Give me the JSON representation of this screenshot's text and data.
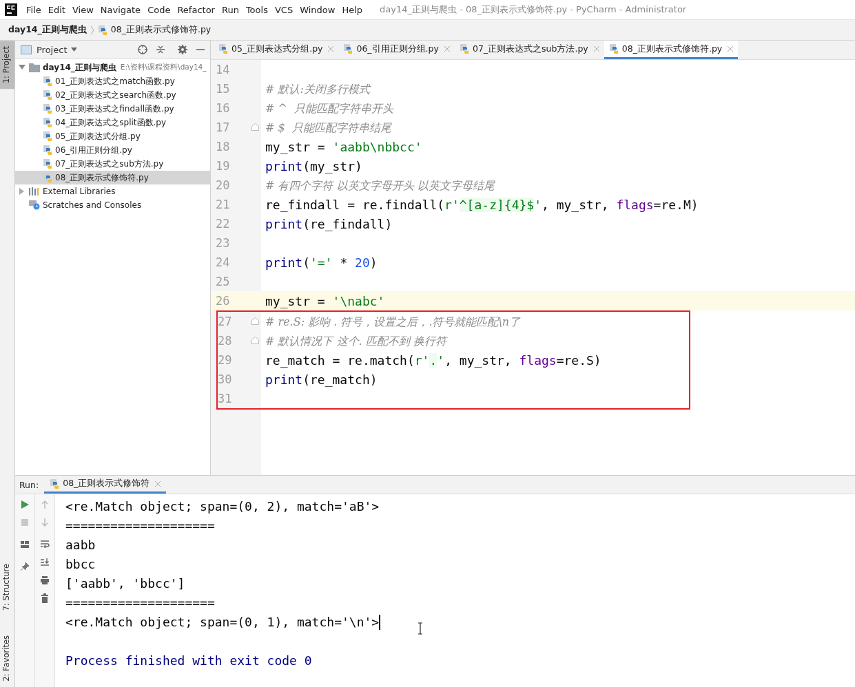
{
  "window": {
    "title": "day14_正则与爬虫 - 08_正则表示式修饰符.py - PyCharm - Administrator",
    "menu": [
      "File",
      "Edit",
      "View",
      "Navigate",
      "Code",
      "Refactor",
      "Run",
      "Tools",
      "VCS",
      "Window",
      "Help"
    ]
  },
  "breadcrumb": [
    "day14_正则与爬虫",
    "08_正则表示式修饰符.py"
  ],
  "left_stripe": [
    {
      "label": "1: Project",
      "selected": true
    },
    {
      "label": "7: Structure",
      "selected": false
    },
    {
      "label": "2: Favorites",
      "selected": false
    }
  ],
  "project_panel": {
    "title": "Project",
    "tree": [
      {
        "label": "day14_正则与爬虫",
        "path": "E:\\资料\\课程资料\\day14_",
        "kind": "folder",
        "expanded": true,
        "selected": false,
        "children": [
          {
            "label": "01_正则表达式之match函数.py",
            "kind": "file",
            "selected": false
          },
          {
            "label": "02_正则表达式之search函数.py",
            "kind": "file",
            "selected": false
          },
          {
            "label": "03_正则表达式之findall函数.py",
            "kind": "file",
            "selected": false
          },
          {
            "label": "04_正则表达式之split函数.py",
            "kind": "file",
            "selected": false
          },
          {
            "label": "05_正则表达式分组.py",
            "kind": "file",
            "selected": false
          },
          {
            "label": "06_引用正则分组.py",
            "kind": "file",
            "selected": false
          },
          {
            "label": "07_正则表达式之sub方法.py",
            "kind": "file",
            "selected": false
          },
          {
            "label": "08_正则表示式修饰符.py",
            "kind": "file",
            "selected": true
          }
        ]
      },
      {
        "label": "External Libraries",
        "kind": "library",
        "expanded": false,
        "selected": false
      },
      {
        "label": "Scratches and Consoles",
        "kind": "scratch",
        "selected": false
      }
    ]
  },
  "editor_tabs": [
    {
      "label": "05_正则表达式分组.py",
      "selected": false
    },
    {
      "label": "06_引用正则分组.py",
      "selected": false
    },
    {
      "label": "07_正则表达式之sub方法.py",
      "selected": false
    },
    {
      "label": "08_正则表示式修饰符.py",
      "selected": true
    }
  ],
  "code_lines": [
    {
      "number": "14",
      "current": false,
      "fold": false,
      "boxed": false
    },
    {
      "number": "15",
      "current": false,
      "fold": false,
      "boxed": false,
      "tokens": [
        {
          "kind": "comment",
          "text": "# 默认:关闭多行模式"
        }
      ]
    },
    {
      "number": "16",
      "current": false,
      "fold": false,
      "boxed": false,
      "tokens": [
        {
          "kind": "comment",
          "text": "# ^  只能匹配字符串开头"
        }
      ]
    },
    {
      "number": "17",
      "current": false,
      "fold": true,
      "boxed": false,
      "tokens": [
        {
          "kind": "comment",
          "text": "# $  只能匹配字符串结尾"
        }
      ]
    },
    {
      "number": "18",
      "current": false,
      "fold": false,
      "boxed": false,
      "tokens": [
        {
          "kind": "plain",
          "text": "my_str = "
        },
        {
          "kind": "string",
          "text": "'aabb\\nbbcc'"
        }
      ]
    },
    {
      "number": "19",
      "current": false,
      "fold": false,
      "boxed": false,
      "tokens": [
        {
          "kind": "builtin",
          "text": "print"
        },
        {
          "kind": "plain",
          "text": "(my_str)"
        }
      ]
    },
    {
      "number": "20",
      "current": false,
      "fold": false,
      "boxed": false,
      "tokens": [
        {
          "kind": "comment",
          "text": "# 有四个字符 以英文字母开头 以英文字母结尾"
        }
      ]
    },
    {
      "number": "21",
      "current": false,
      "fold": false,
      "boxed": false,
      "tokens": [
        {
          "kind": "plain",
          "text": "re_findall = re.findall("
        },
        {
          "kind": "string",
          "text": "r'"
        },
        {
          "kind": "regex",
          "text": "^[a-z]{4}$"
        },
        {
          "kind": "string",
          "text": "'"
        },
        {
          "kind": "plain",
          "text": ", my_str, "
        },
        {
          "kind": "param",
          "text": "flags"
        },
        {
          "kind": "plain",
          "text": "=re.M)"
        }
      ]
    },
    {
      "number": "22",
      "current": false,
      "fold": false,
      "boxed": false,
      "tokens": [
        {
          "kind": "builtin",
          "text": "print"
        },
        {
          "kind": "plain",
          "text": "(re_findall)"
        }
      ]
    },
    {
      "number": "23",
      "current": false,
      "fold": false,
      "boxed": false
    },
    {
      "number": "24",
      "current": false,
      "fold": false,
      "boxed": false,
      "tokens": [
        {
          "kind": "builtin",
          "text": "print"
        },
        {
          "kind": "plain",
          "text": "("
        },
        {
          "kind": "string",
          "text": "'='"
        },
        {
          "kind": "plain",
          "text": " * "
        },
        {
          "kind": "number",
          "text": "20"
        },
        {
          "kind": "plain",
          "text": ")"
        }
      ]
    },
    {
      "number": "25",
      "current": false,
      "fold": false,
      "boxed": false
    },
    {
      "number": "26",
      "current": true,
      "fold": false,
      "boxed": false,
      "tokens": [
        {
          "kind": "plain",
          "text": "my_str = "
        },
        {
          "kind": "string",
          "text": "'\\nabc'"
        }
      ]
    },
    {
      "number": "27",
      "current": false,
      "fold": true,
      "boxed": true,
      "tokens": [
        {
          "kind": "comment",
          "text": "# re.S: 影响 . 符号，设置之后，.符号就能匹配\\n了"
        }
      ]
    },
    {
      "number": "28",
      "current": false,
      "fold": true,
      "boxed": true,
      "tokens": [
        {
          "kind": "comment",
          "text": "# 默认情况下 这个. 匹配不到 换行符"
        }
      ]
    },
    {
      "number": "29",
      "current": false,
      "fold": false,
      "boxed": true,
      "tokens": [
        {
          "kind": "plain",
          "text": "re_match = re.match("
        },
        {
          "kind": "string",
          "text": "r'"
        },
        {
          "kind": "regex",
          "text": "."
        },
        {
          "kind": "string",
          "text": "'"
        },
        {
          "kind": "plain",
          "text": ", my_str, "
        },
        {
          "kind": "param",
          "text": "flags"
        },
        {
          "kind": "plain",
          "text": "=re.S)"
        }
      ]
    },
    {
      "number": "30",
      "current": false,
      "fold": false,
      "boxed": true,
      "tokens": [
        {
          "kind": "builtin",
          "text": "print"
        },
        {
          "kind": "plain",
          "text": "(re_match)"
        }
      ]
    },
    {
      "number": "31",
      "current": false,
      "fold": false,
      "boxed": true
    }
  ],
  "run_panel": {
    "label": "Run:",
    "tabs": [
      {
        "label": "08_正则表示式修饰符",
        "selected": true
      }
    ],
    "output": [
      {
        "kind": "stdout",
        "text": "<re.Match object; span=(0, 2), match='aB'>"
      },
      {
        "kind": "stdout",
        "text": "===================="
      },
      {
        "kind": "stdout",
        "text": "aabb"
      },
      {
        "kind": "stdout",
        "text": "bbcc"
      },
      {
        "kind": "stdout",
        "text": "['aabb', 'bbcc']"
      },
      {
        "kind": "stdout",
        "text": "===================="
      },
      {
        "kind": "stdout",
        "text": "<re.Match object; span=(0, 1), match='\\n'>"
      },
      {
        "kind": "blank"
      },
      {
        "kind": "system",
        "text": "Process finished with exit code 0"
      }
    ]
  }
}
